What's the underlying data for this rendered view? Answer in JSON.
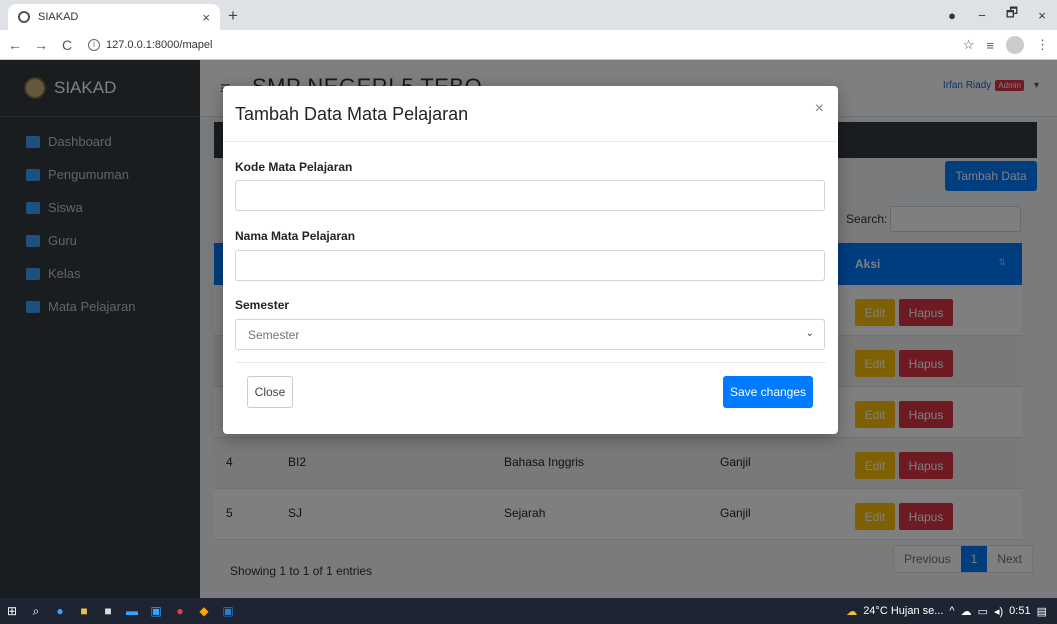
{
  "browser": {
    "tab_title": "SIAKAD",
    "tab_close": "×",
    "new_tab": "+",
    "url": "127.0.0.1:8000/mapel",
    "win_min": "−",
    "win_max": "🗗",
    "win_close": "×"
  },
  "sidebar": {
    "brand": "SIAKAD",
    "items": [
      {
        "label": "Dashboard",
        "color": "#3ba0ff"
      },
      {
        "label": "Pengumuman",
        "color": "#3ba0ff"
      },
      {
        "label": "Siswa",
        "color": "#3ba0ff"
      },
      {
        "label": "Guru",
        "color": "#3ba0ff"
      },
      {
        "label": "Kelas",
        "color": "#3ba0ff"
      },
      {
        "label": "Mata Pelajaran",
        "color": "#3ba0ff"
      }
    ]
  },
  "header": {
    "school": "SMP NEGERI 5 TEBO",
    "user": "Irfan Riady",
    "role": "Admin"
  },
  "content": {
    "add_button": "Tambah Data",
    "search_label": "Search:",
    "aksi_header": "Aksi",
    "rows": [
      {
        "no": "",
        "kode": "",
        "nama": "",
        "semester": ""
      },
      {
        "no": "",
        "kode": "",
        "nama": "",
        "semester": ""
      },
      {
        "no": "",
        "kode": "",
        "nama": "",
        "semester": ""
      },
      {
        "no": "4",
        "kode": "BI2",
        "nama": "Bahasa Inggris",
        "semester": "Ganjil"
      },
      {
        "no": "5",
        "kode": "SJ",
        "nama": "Sejarah",
        "semester": "Ganjil"
      }
    ],
    "edit_label": "Edit",
    "hapus_label": "Hapus",
    "showing": "Showing 1 to 1 of 1 entries",
    "prev": "Previous",
    "page": "1",
    "next": "Next"
  },
  "modal": {
    "title": "Tambah Data Mata Pelajaran",
    "close_x": "×",
    "kode_label": "Kode Mata Pelajaran",
    "kode_value": "",
    "nama_label": "Nama Mata Pelajaran",
    "nama_value": "",
    "semester_label": "Semester",
    "semester_selected": "Semester",
    "close_button": "Close",
    "save_button": "Save changes"
  },
  "taskbar": {
    "weather": "24°C  Hujan se...",
    "time": "0:51"
  }
}
